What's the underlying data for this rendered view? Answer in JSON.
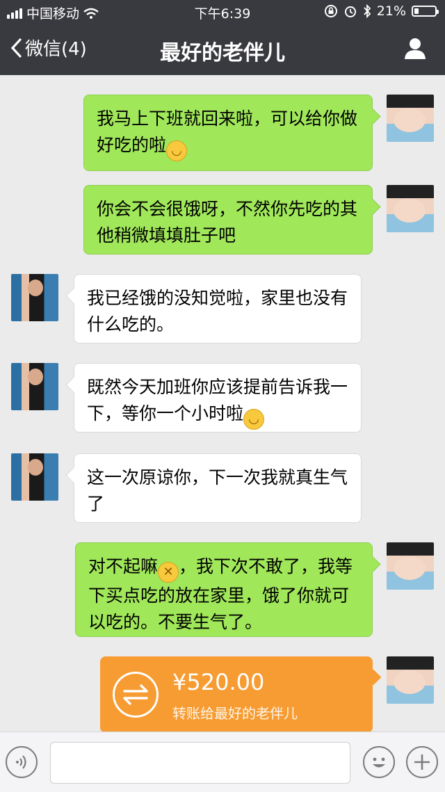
{
  "status_bar": {
    "carrier": "中国移动",
    "time": "下午6:39",
    "battery": "21%",
    "battery_level": 0.21,
    "icons": [
      "signal-icon",
      "wifi-icon",
      "lock-rotation-icon",
      "alarm-icon",
      "bluetooth-icon",
      "battery-icon"
    ]
  },
  "nav": {
    "back_label": "微信(4)",
    "title": "最好的老伴儿",
    "right_icon": "user-profile-icon"
  },
  "messages": [
    {
      "side": "right",
      "text": "我马上下班就回来啦，可以给你做好吃的啦",
      "emoji": "smile"
    },
    {
      "side": "right",
      "text": "你会不会很饿呀，不然你先吃的其他稍微填填肚子吧",
      "emoji": ""
    },
    {
      "side": "left",
      "text": "我已经饿的没知觉啦，家里也没有什么吃的。",
      "emoji": ""
    },
    {
      "side": "left",
      "text": "既然今天加班你应该提前告诉我一下，等你一个小时啦",
      "emoji": "smile"
    },
    {
      "side": "left",
      "text": "这一次原谅你，下一次我就真生气了",
      "emoji": ""
    },
    {
      "side": "right",
      "text_before": "对不起嘛",
      "text_after": "，我下次不敢了，我等下买点吃的放在家里，饿了你就可以吃的。不要生气了。",
      "emoji": "shy"
    }
  ],
  "transfer": {
    "amount": "¥520.00",
    "note": "转账给最好的老伴儿",
    "color": "#f79c32"
  },
  "input_bar": {
    "text_value": "",
    "icons": [
      "voice-icon",
      "emoji-icon",
      "plus-icon"
    ]
  },
  "colors": {
    "header": "#393a3f",
    "my_bubble": "#a0e75a",
    "their_bubble": "#ffffff",
    "chat_background": "#ebebeb"
  }
}
